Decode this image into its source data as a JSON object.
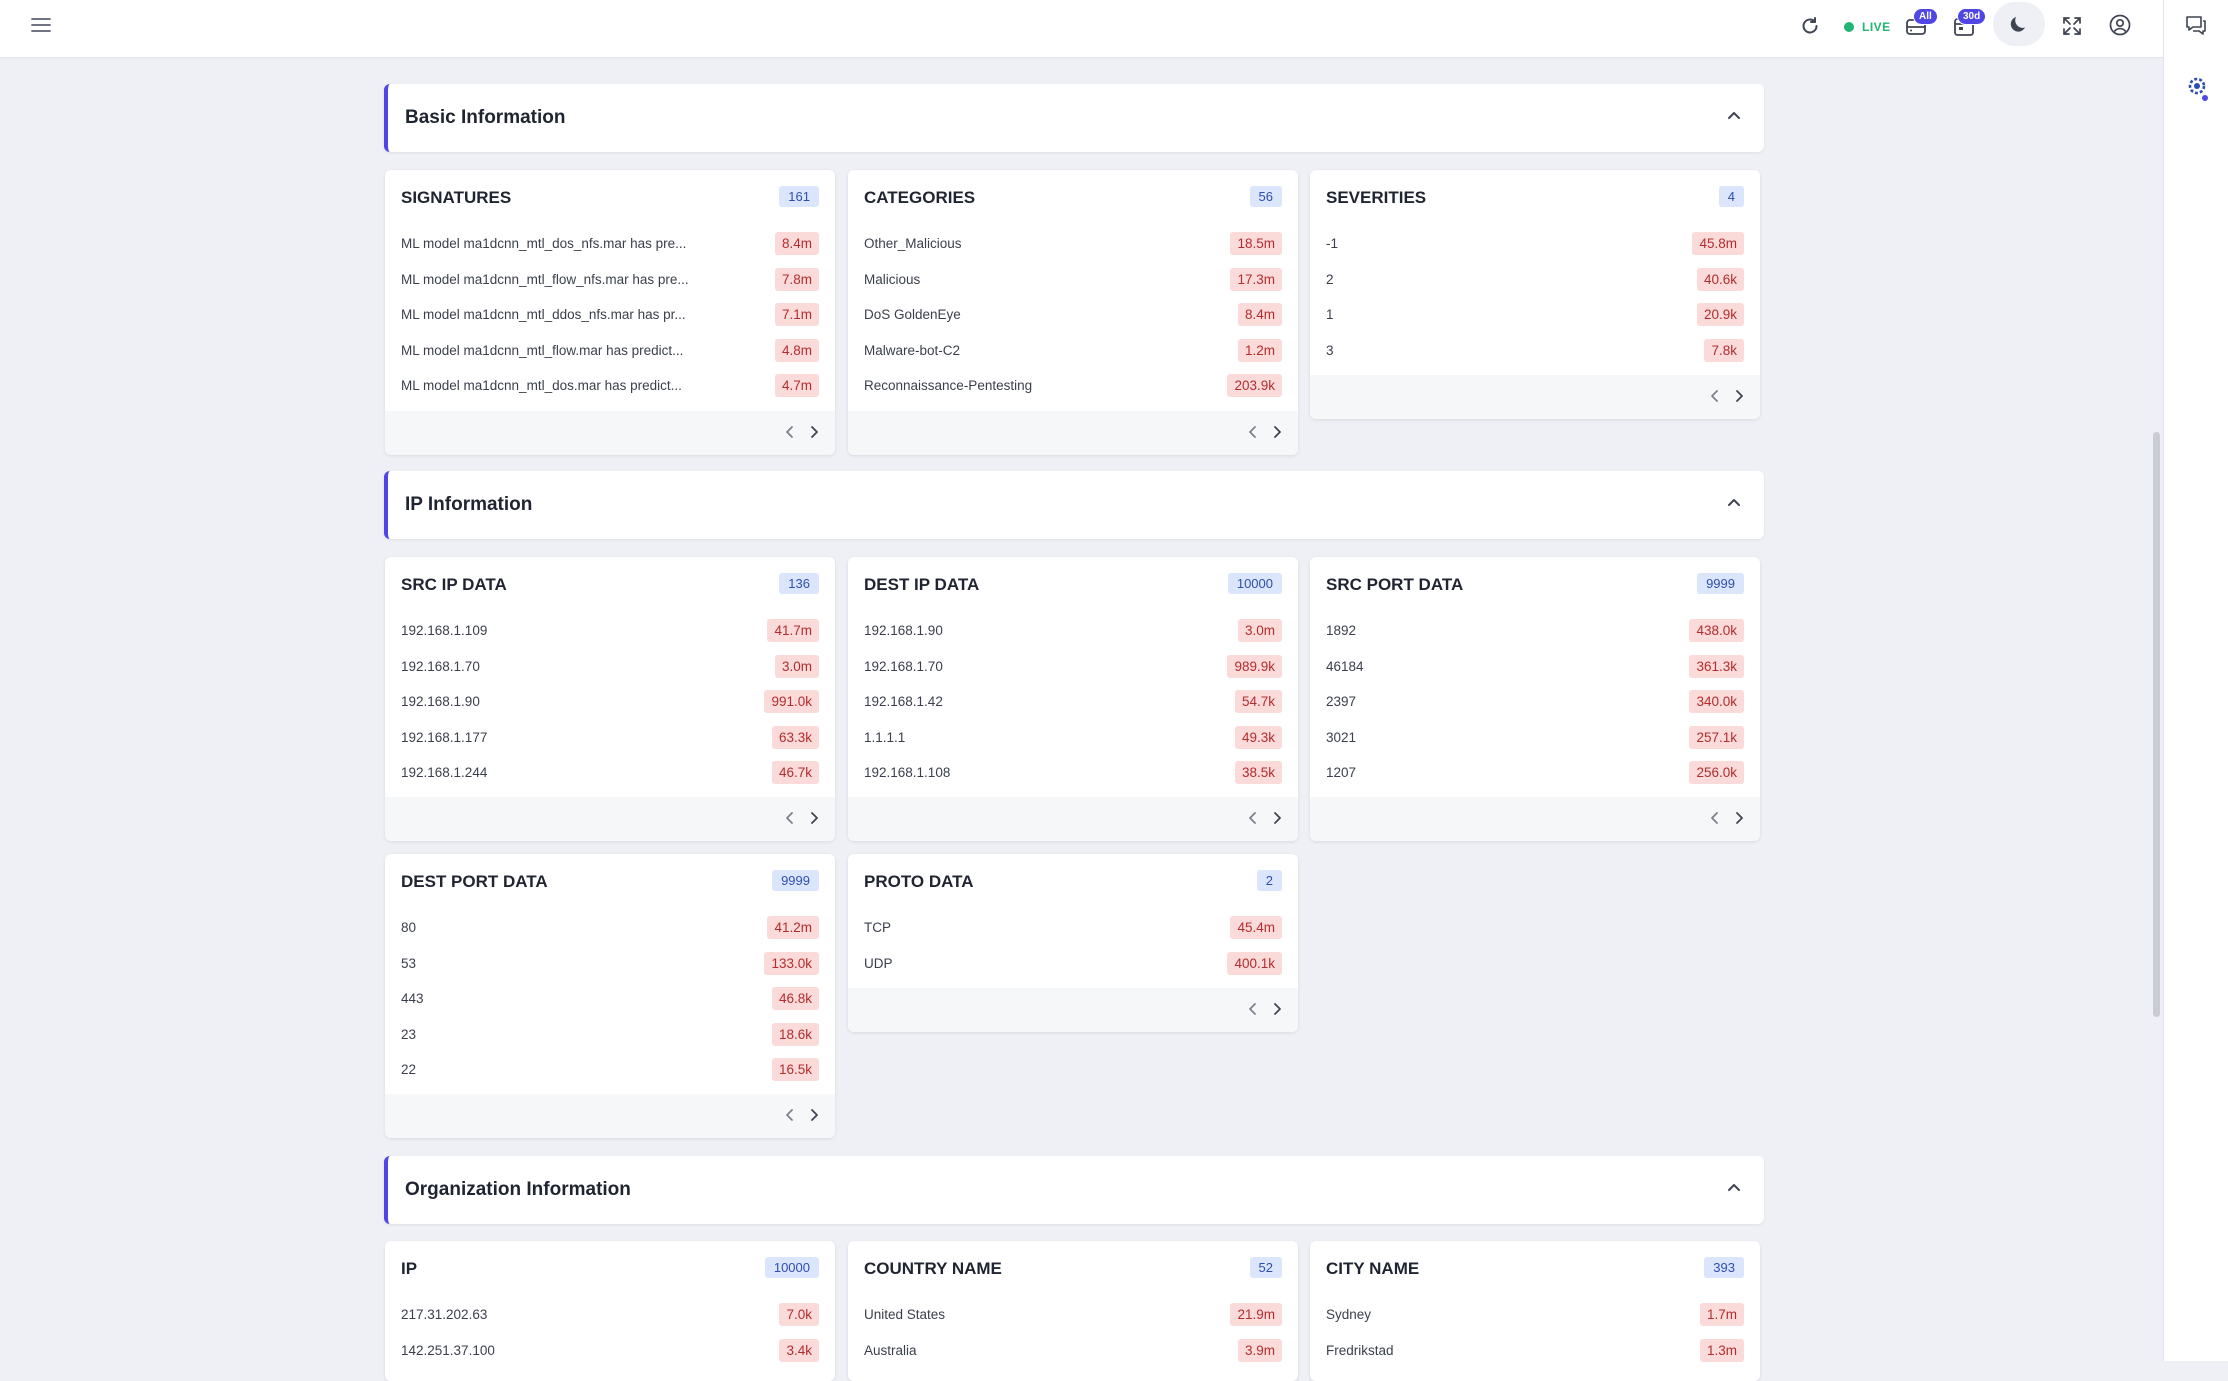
{
  "topbar": {
    "live_label": "LIVE",
    "filter_badge": "All",
    "range_badge": "30d",
    "icons": [
      "menu-icon",
      "refresh-icon",
      "live-dot",
      "database-icon",
      "calendar-icon",
      "moon-icon",
      "fullscreen-icon",
      "user-circle-icon",
      "chat-icon",
      "settings-gear-icon"
    ],
    "accent_color": "#4f46e5"
  },
  "sections": {
    "basic": {
      "title": "Basic Information"
    },
    "ip": {
      "title": "IP Information"
    },
    "org": {
      "title": "Organization Information"
    }
  },
  "cards": {
    "signatures": {
      "title": "SIGNATURES",
      "count": "161",
      "rows": [
        {
          "label": "ML model ma1dcnn_mtl_dos_nfs.mar has pre...",
          "value": "8.4m"
        },
        {
          "label": "ML model ma1dcnn_mtl_flow_nfs.mar has pre...",
          "value": "7.8m"
        },
        {
          "label": "ML model ma1dcnn_mtl_ddos_nfs.mar has pr...",
          "value": "7.1m"
        },
        {
          "label": "ML model ma1dcnn_mtl_flow.mar has predict...",
          "value": "4.8m"
        },
        {
          "label": "ML model ma1dcnn_mtl_dos.mar has predict...",
          "value": "4.7m"
        }
      ]
    },
    "categories": {
      "title": "CATEGORIES",
      "count": "56",
      "rows": [
        {
          "label": "Other_Malicious",
          "value": "18.5m"
        },
        {
          "label": "Malicious",
          "value": "17.3m"
        },
        {
          "label": "DoS GoldenEye",
          "value": "8.4m"
        },
        {
          "label": "Malware-bot-C2",
          "value": "1.2m"
        },
        {
          "label": "Reconnaissance-Pentesting",
          "value": "203.9k"
        }
      ]
    },
    "severities": {
      "title": "SEVERITIES",
      "count": "4",
      "rows": [
        {
          "label": "-1",
          "value": "45.8m"
        },
        {
          "label": "2",
          "value": "40.6k"
        },
        {
          "label": "1",
          "value": "20.9k"
        },
        {
          "label": "3",
          "value": "7.8k"
        }
      ]
    },
    "src_ip": {
      "title": "SRC IP DATA",
      "count": "136",
      "rows": [
        {
          "label": "192.168.1.109",
          "value": "41.7m"
        },
        {
          "label": "192.168.1.70",
          "value": "3.0m"
        },
        {
          "label": "192.168.1.90",
          "value": "991.0k"
        },
        {
          "label": "192.168.1.177",
          "value": "63.3k"
        },
        {
          "label": "192.168.1.244",
          "value": "46.7k"
        }
      ]
    },
    "dest_ip": {
      "title": "DEST IP DATA",
      "count": "10000",
      "rows": [
        {
          "label": "192.168.1.90",
          "value": "3.0m"
        },
        {
          "label": "192.168.1.70",
          "value": "989.9k"
        },
        {
          "label": "192.168.1.42",
          "value": "54.7k"
        },
        {
          "label": "1.1.1.1",
          "value": "49.3k"
        },
        {
          "label": "192.168.1.108",
          "value": "38.5k"
        }
      ]
    },
    "src_port": {
      "title": "SRC PORT DATA",
      "count": "9999",
      "rows": [
        {
          "label": "1892",
          "value": "438.0k"
        },
        {
          "label": "46184",
          "value": "361.3k"
        },
        {
          "label": "2397",
          "value": "340.0k"
        },
        {
          "label": "3021",
          "value": "257.1k"
        },
        {
          "label": "1207",
          "value": "256.0k"
        }
      ]
    },
    "dest_port": {
      "title": "DEST PORT DATA",
      "count": "9999",
      "rows": [
        {
          "label": "80",
          "value": "41.2m"
        },
        {
          "label": "53",
          "value": "133.0k"
        },
        {
          "label": "443",
          "value": "46.8k"
        },
        {
          "label": "23",
          "value": "18.6k"
        },
        {
          "label": "22",
          "value": "16.5k"
        }
      ]
    },
    "proto": {
      "title": "PROTO DATA",
      "count": "2",
      "rows": [
        {
          "label": "TCP",
          "value": "45.4m"
        },
        {
          "label": "UDP",
          "value": "400.1k"
        }
      ]
    },
    "org_ip": {
      "title": "IP",
      "count": "10000",
      "rows": [
        {
          "label": "217.31.202.63",
          "value": "7.0k"
        },
        {
          "label": "142.251.37.100",
          "value": "3.4k"
        }
      ]
    },
    "country": {
      "title": "COUNTRY NAME",
      "count": "52",
      "rows": [
        {
          "label": "United States",
          "value": "21.9m"
        },
        {
          "label": "Australia",
          "value": "3.9m"
        }
      ]
    },
    "city": {
      "title": "CITY NAME",
      "count": "393",
      "rows": [
        {
          "label": "Sydney",
          "value": "1.7m"
        },
        {
          "label": "Fredrikstad",
          "value": "1.3m"
        }
      ]
    }
  }
}
